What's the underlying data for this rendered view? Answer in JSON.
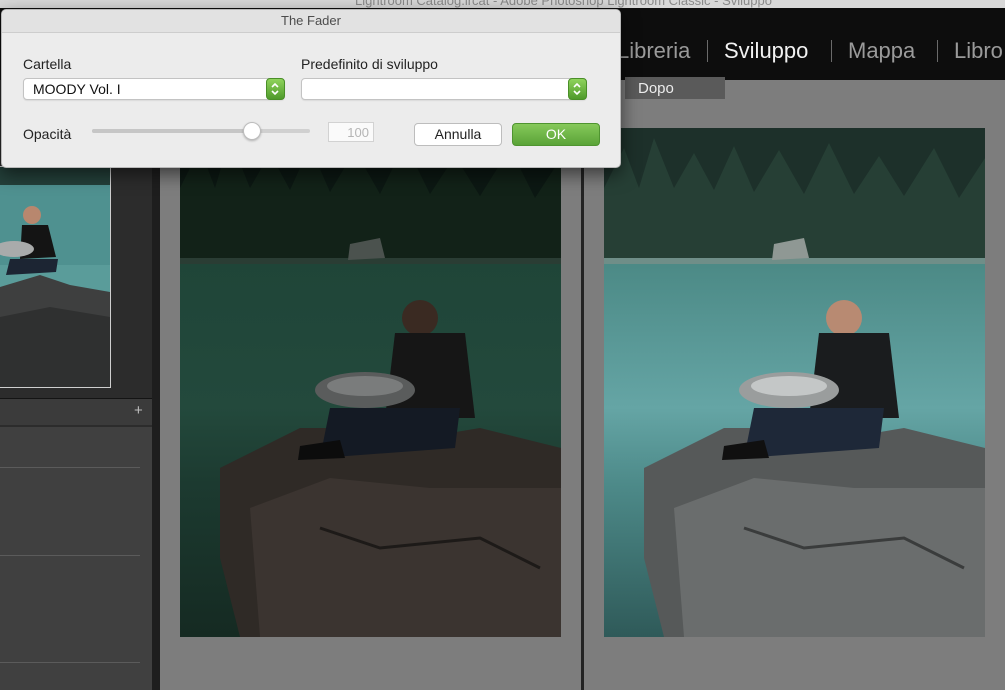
{
  "window": {
    "title": "Lightroom Catalog.lrcat - Adobe Photoshop Lightroom Classic - Sviluppo"
  },
  "modules": {
    "items": [
      {
        "label": "Libreria",
        "active": false
      },
      {
        "label": "Sviluppo",
        "active": true
      },
      {
        "label": "Mappa",
        "active": false
      },
      {
        "label": "Libro",
        "active": false
      }
    ]
  },
  "comparison": {
    "after_label": "Dopo"
  },
  "left_panel": {
    "add_icon": "plus-icon"
  },
  "dialog": {
    "title": "The Fader",
    "folder": {
      "label": "Cartella",
      "value": "MOODY Vol. I"
    },
    "preset": {
      "label": "Predefinito di sviluppo",
      "value": ""
    },
    "opacity": {
      "label": "Opacità",
      "value": "100",
      "slider_fraction": 0.73
    },
    "buttons": {
      "cancel": "Annulla",
      "ok": "OK"
    }
  },
  "colors": {
    "ok_button": "#6ab243",
    "stepper": "#5fb03a",
    "module_bar": "#0d0d0d"
  }
}
